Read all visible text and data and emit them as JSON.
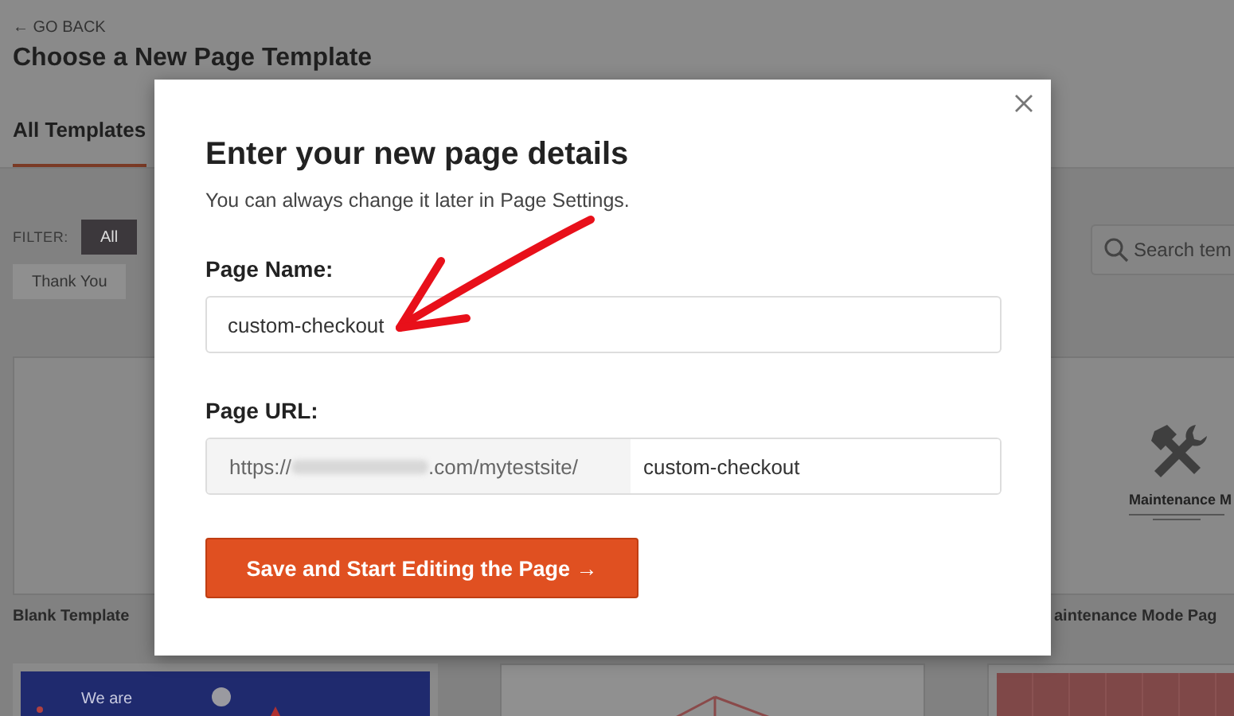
{
  "page": {
    "back_link": "← GO BACK",
    "title": "Choose a New Page Template",
    "tabs": [
      {
        "label": "All Templates",
        "selected": true
      }
    ],
    "filter": {
      "label": "FILTER:",
      "chips": [
        {
          "label": "All",
          "selected": true
        },
        {
          "label": "Thank You",
          "selected": false
        }
      ]
    },
    "search": {
      "placeholder": "Search tem"
    },
    "template_rows": [
      [
        {
          "kind": "blank",
          "name": "Blank Template"
        },
        {
          "kind": "maintenance",
          "name": "aintenance Mode Pag",
          "preview_title": "Maintenance M"
        }
      ],
      [
        {
          "kind": "promo",
          "preview_title": "We are"
        },
        {
          "kind": "chart"
        },
        {
          "kind": "grid"
        }
      ]
    ]
  },
  "dialog": {
    "title": "Enter your new page details",
    "subtitle": "You can always change it later in Page Settings.",
    "name_field": {
      "label": "Page Name:",
      "value": "custom-checkout"
    },
    "url_field": {
      "label": "Page URL:",
      "prefix_start": "https://",
      "prefix_end": ".com/mytestsite/",
      "value": "custom-checkout"
    },
    "submit": "Save and Start Editing the Page →"
  }
}
